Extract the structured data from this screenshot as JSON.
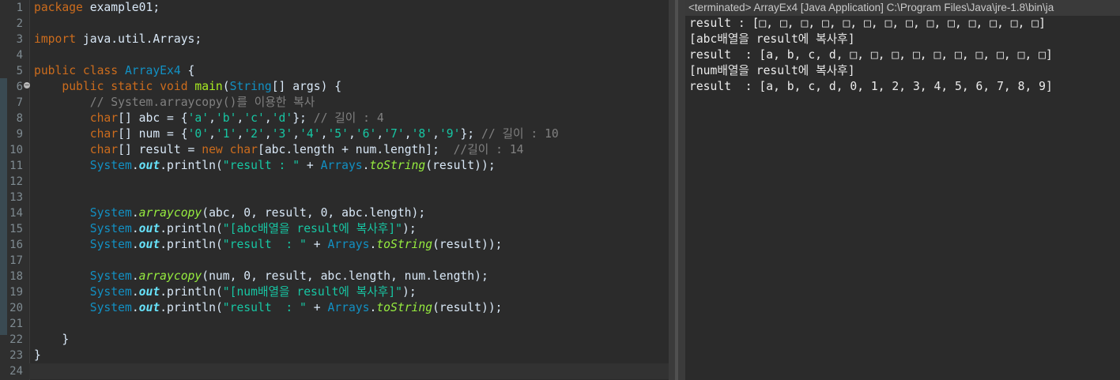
{
  "editor": {
    "line_numbers": [
      "1",
      "2",
      "3",
      "4",
      "5",
      "6",
      "7",
      "8",
      "9",
      "10",
      "11",
      "12",
      "13",
      "14",
      "15",
      "16",
      "17",
      "18",
      "19",
      "20",
      "21",
      "22",
      "23",
      "24"
    ],
    "code": {
      "l1_kw": "package",
      "l1_rest": " example01;",
      "l3_kw": "import",
      "l3_rest": " java.util.Arrays;",
      "l5_kw1": "public",
      "l5_kw2": "class",
      "l5_cls": "ArrayEx4",
      "l5_rest": " {",
      "l6_kw1": "public",
      "l6_kw2": "static",
      "l6_kw3": "void",
      "l6_fn": "main",
      "l6_p1": "(",
      "l6_ty": "String",
      "l6_rest": "[] args) {",
      "l7_comment": "// System.arraycopy()를 이용한 복사",
      "l8_ty": "char",
      "l8_a": "[] abc = {",
      "l8_s1": "'a'",
      "l8_s2": "'b'",
      "l8_s3": "'c'",
      "l8_s4": "'d'",
      "l8_b": "}; ",
      "l8_comment": "// 길이 : 4",
      "l9_ty": "char",
      "l9_a": "[] num = {",
      "l9_s0": "'0'",
      "l9_s1": "'1'",
      "l9_s2": "'2'",
      "l9_s3": "'3'",
      "l9_s4": "'4'",
      "l9_s5": "'5'",
      "l9_s6": "'6'",
      "l9_s7": "'7'",
      "l9_s8": "'8'",
      "l9_s9": "'9'",
      "l9_b": "}; ",
      "l9_comment": "// 길이 : 10",
      "l10_ty1": "char",
      "l10_a": "[] result = ",
      "l10_kw": "new",
      "l10_ty2": "char",
      "l10_b": "[abc.length + num.length];  ",
      "l10_comment": "//길이 : 14",
      "l11_sys": "System",
      "l11_fld": "out",
      "l11_m": "println",
      "l11_s": "\"result : \"",
      "l11_plus": " + ",
      "l11_cls": "Arrays",
      "l11_st": "toString",
      "l11_end": "(result));",
      "l14_sys": "System",
      "l14_st": "arraycopy",
      "l14_rest": "(abc, 0, result, 0, abc.length);",
      "l15_sys": "System",
      "l15_fld": "out",
      "l15_m": "println",
      "l15_s": "\"[abc배열을 result에 복사후]\"",
      "l15_end": ");",
      "l16_sys": "System",
      "l16_fld": "out",
      "l16_m": "println",
      "l16_s": "\"result  : \"",
      "l16_plus": " + ",
      "l16_cls": "Arrays",
      "l16_st": "toString",
      "l16_end": "(result));",
      "l18_sys": "System",
      "l18_st": "arraycopy",
      "l18_rest": "(num, 0, result, abc.length, num.length);",
      "l19_sys": "System",
      "l19_fld": "out",
      "l19_m": "println",
      "l19_s": "\"[num배열을 result에 복사후]\"",
      "l19_end": ");",
      "l20_sys": "System",
      "l20_fld": "out",
      "l20_m": "println",
      "l20_s": "\"result  : \"",
      "l20_plus": " + ",
      "l20_cls": "Arrays",
      "l20_st": "toString",
      "l20_end": "(result));",
      "l22": "}",
      "l23": "}"
    }
  },
  "console": {
    "header": "<terminated> ArrayEx4 [Java Application] C:\\Program Files\\Java\\jre-1.8\\bin\\ja",
    "lines": [
      "result : [□, □, □, □, □, □, □, □, □, □, □, □, □, □]",
      "[abc배열을 result에 복사후]",
      "result  : [a, b, c, d, □, □, □, □, □, □, □, □, □, □]",
      "[num배열을 result에 복사후]",
      "result  : [a, b, c, d, 0, 1, 2, 3, 4, 5, 6, 7, 8, 9]"
    ]
  },
  "colors": {
    "keyword": "#cc6c1d",
    "type": "#1290c3",
    "method_decl": "#a7ec21",
    "string": "#17c6a3",
    "comment": "#808080",
    "static_field": "#66e1f8",
    "editor_bg": "#2b2b2b"
  }
}
